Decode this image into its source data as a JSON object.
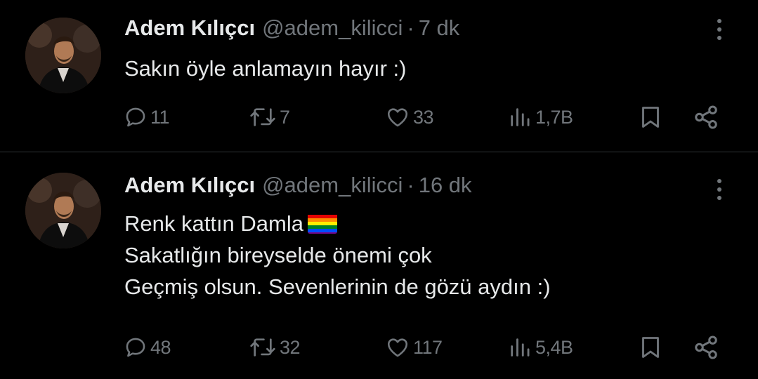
{
  "tweets": [
    {
      "display_name": "Adem Kılıçcı",
      "handle": "@adem_kilicci",
      "separator": "·",
      "time": "7 dk",
      "lines": [
        "Sakın öyle anlamayın hayır :)"
      ],
      "replies": "11",
      "retweets": "7",
      "likes": "33",
      "views": "1,7B"
    },
    {
      "display_name": "Adem Kılıçcı",
      "handle": "@adem_kilicci",
      "separator": "·",
      "time": "16 dk",
      "lines": [
        "Renk kattın Damla",
        "Sakatlığın bireyselde önemi çok",
        "Geçmiş olsun. Sevenlerinin de gözü aydın :)"
      ],
      "emoji": "rainbow-flag",
      "replies": "48",
      "retweets": "32",
      "likes": "117",
      "views": "5,4B"
    }
  ],
  "colors": {
    "background": "#000000",
    "primary_text": "#e7e9ea",
    "secondary_text": "#71767b",
    "divider": "#2f3336"
  },
  "icons": [
    "reply-icon",
    "retweet-icon",
    "like-icon",
    "views-icon",
    "bookmark-icon",
    "share-icon",
    "more-icon"
  ]
}
